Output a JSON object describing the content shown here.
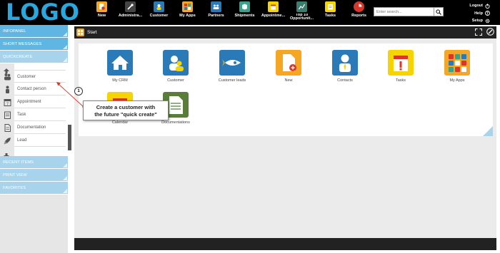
{
  "header": {
    "logo": "LOGO",
    "nav": [
      {
        "label": "New",
        "icon": "new-icon",
        "color": "#f5a623"
      },
      {
        "label": "Administra...",
        "icon": "wrench-icon",
        "color": "#444444"
      },
      {
        "label": "Customer",
        "icon": "customer-icon",
        "color": "#2a7ab8"
      },
      {
        "label": "My Apps",
        "icon": "apps-icon",
        "color": "#f5a623"
      },
      {
        "label": "Partners",
        "icon": "partners-icon",
        "color": "#2a7ab8"
      },
      {
        "label": "Shipments",
        "icon": "shipment-icon",
        "color": "#3aa28b"
      },
      {
        "label": "Appointme...",
        "icon": "calendar-icon",
        "color": "#f5d400"
      },
      {
        "label": "Top 10 Opportunit...",
        "icon": "chart-icon",
        "color": "#3a7d6c"
      },
      {
        "label": "Tasks",
        "icon": "tasks-icon",
        "color": "#f5d400"
      },
      {
        "label": "Reports",
        "icon": "reports-icon",
        "color": "#d9362b"
      }
    ],
    "search_placeholder": "Enter search...",
    "links": {
      "logout": "Logout",
      "help": "Help",
      "setup": "Setup"
    }
  },
  "sidebar": {
    "infopanel": "INFOPANEL",
    "short_messages": "SHORT MESSAGES",
    "quickcreate": "QUICKCREATE",
    "qc_items": [
      "Customer",
      "Contact person",
      "Appointment",
      "Task",
      "Documentation",
      "Lead"
    ],
    "recent_items": "RECENT ITEMS",
    "print_view": "PRINT VIEW",
    "favorites": "FAVORITES"
  },
  "content": {
    "title": "Start",
    "tiles": [
      {
        "label": "My CRM",
        "icon": "home-icon",
        "color": "#2a7ab8"
      },
      {
        "label": "Customer",
        "icon": "customer-icon",
        "color": "#2a7ab8"
      },
      {
        "label": "Customer leads",
        "icon": "rocket-icon",
        "color": "#2a7ab8"
      },
      {
        "label": "New",
        "icon": "new-doc-icon",
        "color": "#f5a623"
      },
      {
        "label": "Contacts",
        "icon": "contact-icon",
        "color": "#2a7ab8"
      },
      {
        "label": "Tasks",
        "icon": "tasks-icon",
        "color": "#f5d400"
      },
      {
        "label": "My Apps",
        "icon": "apps-icon",
        "color": "#f5a623"
      },
      {
        "label": "Calendar",
        "icon": "calendar-icon",
        "color": "#f5d400"
      },
      {
        "label": "Documentations",
        "icon": "documentation-icon",
        "color": "#5a7d3a"
      }
    ]
  },
  "callout": {
    "number": "1",
    "line1": "Create a customer with",
    "line2": "the future \"quick create\""
  }
}
